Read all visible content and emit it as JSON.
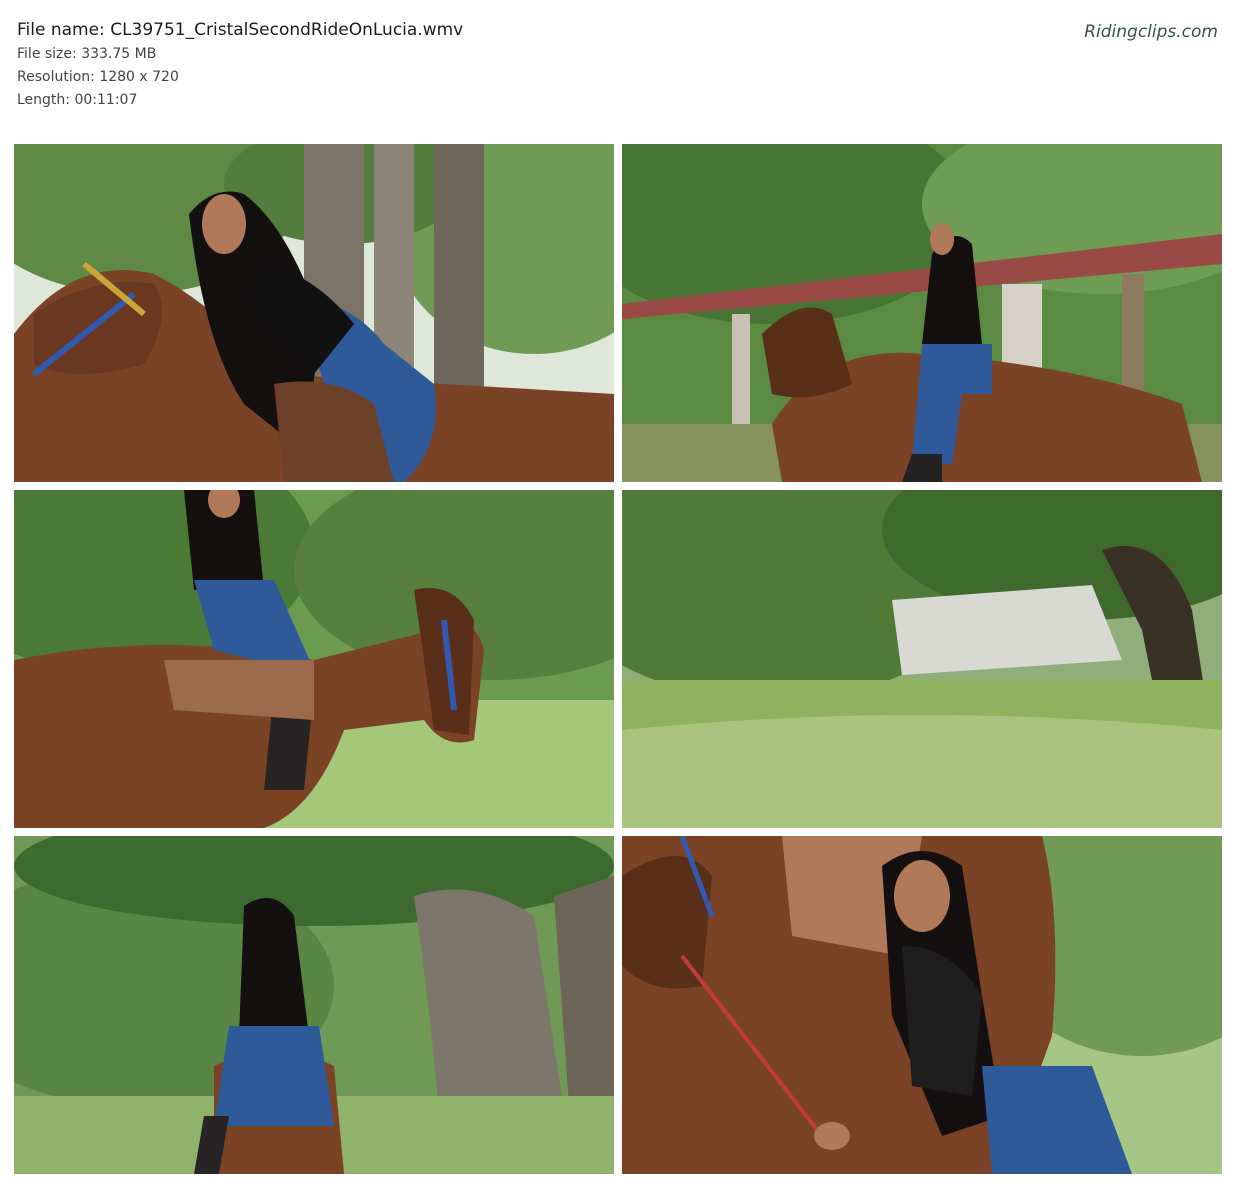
{
  "header": {
    "file_name_label": "File name:",
    "file_name": "CL39751_CristalSecondRideOnLucia.wmv",
    "file_size_label": "File size:",
    "file_size": "333.75 MB",
    "resolution_label": "Resolution:",
    "resolution": "1280 x 720",
    "length_label": "Length:",
    "length": "00:11:07"
  },
  "brand": "Ridingclips.com",
  "colors": {
    "foliage": "#4c7a38",
    "horse": "#7a4326",
    "jeans": "#2f5a9a",
    "hair": "#141010",
    "sky": "#dfe7d8"
  },
  "thumbnails": [
    {
      "scene": "rider-mounting-horse-under-tree"
    },
    {
      "scene": "rider-on-horse-by-shelter"
    },
    {
      "scene": "rider-galloping-through-grass"
    },
    {
      "scene": "empty-field-with-ruined-wall"
    },
    {
      "scene": "rider-from-behind-by-tree"
    },
    {
      "scene": "rider-standing-beside-horse"
    }
  ]
}
